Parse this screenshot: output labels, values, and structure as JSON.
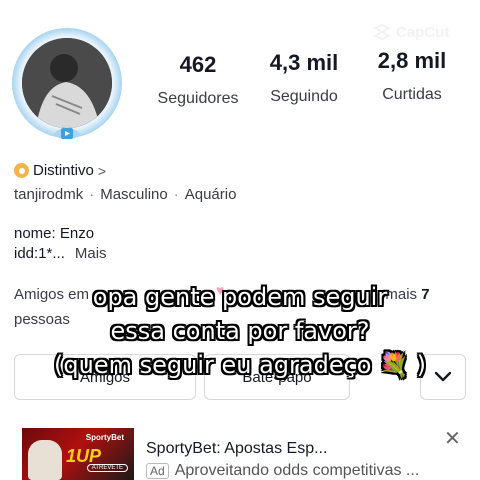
{
  "watermark": {
    "text": "CapCut"
  },
  "stats": [
    {
      "value": "462",
      "label": "Seguidores"
    },
    {
      "value": "4,3 mil",
      "label": "Seguindo"
    },
    {
      "value": "2,8 mil",
      "label": "Curtidas"
    }
  ],
  "badge": {
    "label": "Distintivo",
    "chevron": ">"
  },
  "profile_meta": {
    "username": "tanjirodmk",
    "gender": "Masculino",
    "sign": "Aquário",
    "separator": "·"
  },
  "bio": {
    "line1": "nome: Enzo",
    "line2": "idd:1*...",
    "more": "Mais"
  },
  "friends": {
    "prefix": "Amigos em",
    "suffix": "mais",
    "count": "7",
    "line2": "pessoas"
  },
  "buttons": {
    "friends": "Amigos",
    "chat": "Bate-papo",
    "more_icon": "chevron-down-icon"
  },
  "ad": {
    "title": "SportyBet: Apostas Esp...",
    "tag": "Ad",
    "description": "Aproveitando odds competitivas ...",
    "thumb_brand": "SportyBet",
    "thumb_big": "1UP",
    "thumb_cta": "ATREVETE",
    "close_icon": "close-icon"
  },
  "caption": {
    "line1": "opa gente podem seguir",
    "line2": "essa conta por favor?",
    "line3": "(quem seguir eu agradeço 💐 )"
  },
  "colors": {
    "badge_orange": "#f4b24a",
    "ring_blue": "#9fd0ee"
  }
}
